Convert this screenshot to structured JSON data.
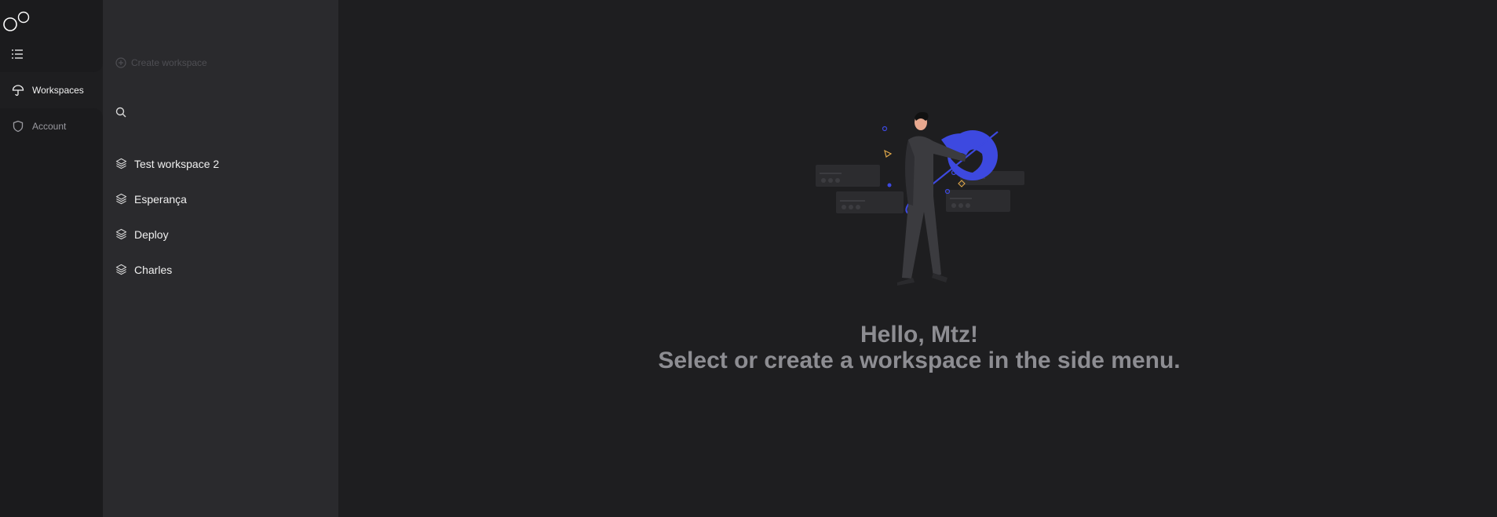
{
  "nav": {
    "items": [
      {
        "label": "Workspaces",
        "icon": "umbrella-icon",
        "active": true
      },
      {
        "label": "Account",
        "icon": "shield-icon",
        "active": false
      }
    ]
  },
  "panel": {
    "create_label": "Create workspace",
    "search_placeholder": "",
    "workspaces": [
      {
        "label": "Test workspace 2"
      },
      {
        "label": "Esperança"
      },
      {
        "label": "Deploy"
      },
      {
        "label": "Charles"
      }
    ]
  },
  "main": {
    "greeting_line1": "Hello, Mtz!",
    "greeting_line2": "Select or create a workspace in the side menu."
  },
  "colors": {
    "accent": "#3d49e0",
    "background": "#1e1e20",
    "panel": "#2a2a2d"
  }
}
